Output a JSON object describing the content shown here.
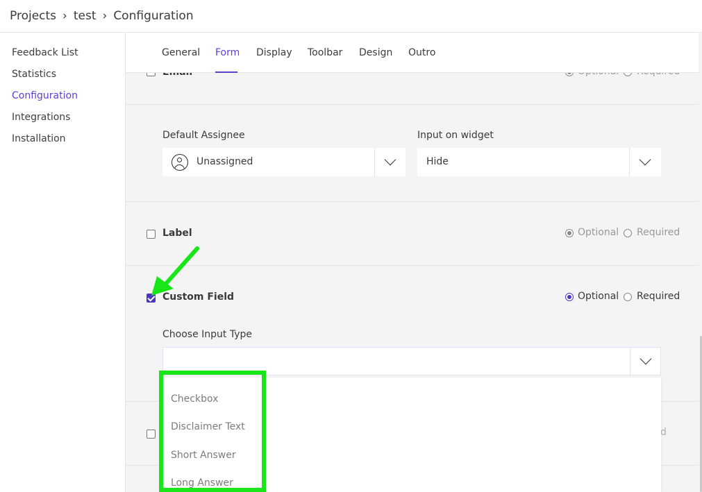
{
  "breadcrumb": {
    "items": [
      "Projects",
      "test",
      "Configuration"
    ],
    "separator": "›"
  },
  "sidebar": {
    "items": [
      {
        "label": "Feedback List",
        "active": false
      },
      {
        "label": "Statistics",
        "active": false
      },
      {
        "label": "Configuration",
        "active": true
      },
      {
        "label": "Integrations",
        "active": false
      },
      {
        "label": "Installation",
        "active": false
      }
    ]
  },
  "tabs": {
    "items": [
      "General",
      "Form",
      "Display",
      "Toolbar",
      "Design",
      "Outro"
    ],
    "active": "Form"
  },
  "email_row": {
    "label": "Email",
    "option_optional": "Optional",
    "option_required": "Required"
  },
  "assignee_section": {
    "default_assignee_label": "Default Assignee",
    "default_assignee_value": "Unassigned",
    "input_on_widget_label": "Input on widget",
    "input_on_widget_value": "Hide"
  },
  "label_row": {
    "label": "Label",
    "checked": false,
    "option_optional": "Optional",
    "option_required": "Required",
    "selected": "Optional"
  },
  "custom_field_row": {
    "label": "Custom Field",
    "checked": true,
    "option_optional": "Optional",
    "option_required": "Required",
    "selected": "Optional",
    "input_type_label": "Choose Input Type",
    "input_type_value": ""
  },
  "next_row": {
    "required_cut": "ired"
  },
  "dropdown": {
    "options": [
      "Checkbox",
      "Disclaimer Text",
      "Short Answer",
      "Long Answer"
    ]
  },
  "colors": {
    "accent": "#5b3fd6",
    "checkbox_accent": "#4b36c4",
    "annotation_green": "#19e619"
  }
}
